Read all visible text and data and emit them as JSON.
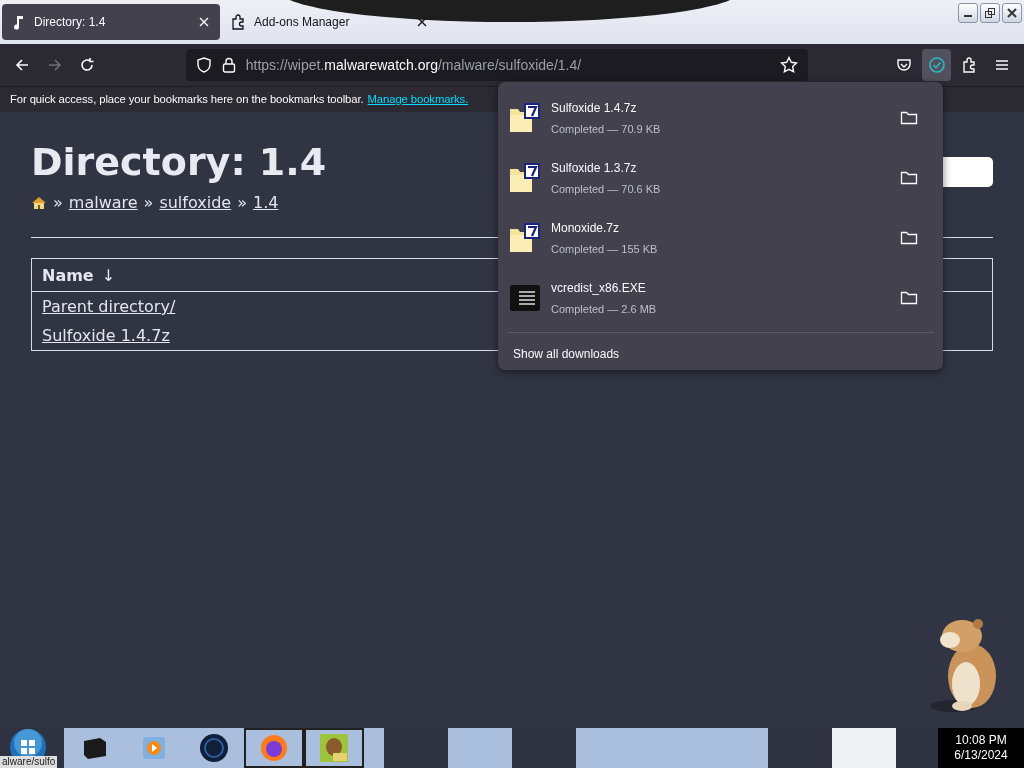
{
  "tabs": [
    {
      "title": "Directory: 1.4",
      "kind": "page",
      "selected": true
    },
    {
      "title": "Add-ons Manager",
      "kind": "addons",
      "selected": false
    }
  ],
  "address": {
    "prefix": "https://wipet.",
    "domain": "malwarewatch.org",
    "path": "/malware/sulfoxide/1.4/"
  },
  "bookmarks_bar": {
    "text": "For quick access, place your bookmarks here on the bookmarks toolbar.",
    "link": "Manage bookmarks."
  },
  "page": {
    "heading": "Directory: 1.4",
    "breadcrumb": [
      {
        "separator": "»",
        "label": "malware"
      },
      {
        "separator": "»",
        "label": "sulfoxide"
      },
      {
        "separator": "»",
        "label": "1.4"
      }
    ],
    "table": {
      "column": "Name",
      "sort_indicator": "↓",
      "rows": [
        "Parent directory/",
        "Sulfoxide 1.4.7z"
      ]
    }
  },
  "downloads": {
    "items": [
      {
        "name": "Sulfoxide 1.4.7z",
        "status": "Completed — 70.9 KB",
        "kind": "archive"
      },
      {
        "name": "Sulfoxide 1.3.7z",
        "status": "Completed — 70.6 KB",
        "kind": "archive"
      },
      {
        "name": "Monoxide.7z",
        "status": "Completed — 155 KB",
        "kind": "archive"
      },
      {
        "name": "vcredist_x86.EXE",
        "status": "Completed — 2.6 MB",
        "kind": "executable"
      }
    ],
    "footer": "Show all downloads"
  },
  "status_url": "alware/sulfo",
  "taskbar": {
    "time": "10:08 PM",
    "date": "6/13/2024"
  }
}
